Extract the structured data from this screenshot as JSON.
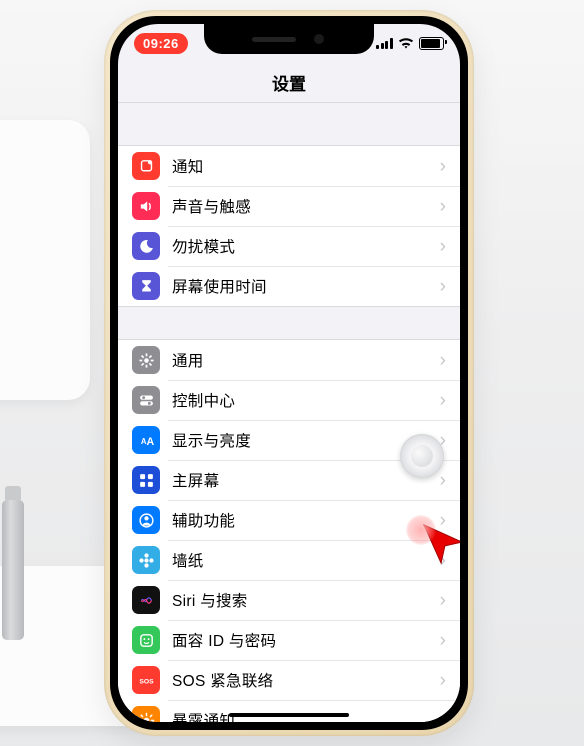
{
  "status": {
    "time": "09:26"
  },
  "header": {
    "title": "设置"
  },
  "groups": [
    {
      "items": [
        {
          "id": "notifications",
          "label": "通知",
          "icon": "bell",
          "color": "c-red"
        },
        {
          "id": "sounds",
          "label": "声音与触感",
          "icon": "speaker",
          "color": "c-pink"
        },
        {
          "id": "dnd",
          "label": "勿扰模式",
          "icon": "moon",
          "color": "c-purple"
        },
        {
          "id": "screentime",
          "label": "屏幕使用时间",
          "icon": "hourglass",
          "color": "c-purple"
        }
      ]
    },
    {
      "items": [
        {
          "id": "general",
          "label": "通用",
          "icon": "gear",
          "color": "c-grey"
        },
        {
          "id": "control",
          "label": "控制中心",
          "icon": "toggles",
          "color": "c-grey"
        },
        {
          "id": "display",
          "label": "显示与亮度",
          "icon": "aa",
          "color": "c-blue"
        },
        {
          "id": "homescreen",
          "label": "主屏幕",
          "icon": "grid",
          "color": "c-darkblue"
        },
        {
          "id": "accessibility",
          "label": "辅助功能",
          "icon": "person",
          "color": "c-blue"
        },
        {
          "id": "wallpaper",
          "label": "墙纸",
          "icon": "flower",
          "color": "c-cyan"
        },
        {
          "id": "siri",
          "label": "Siri 与搜索",
          "icon": "siri",
          "color": "c-black"
        },
        {
          "id": "faceid",
          "label": "面容 ID 与密码",
          "icon": "face",
          "color": "c-green"
        },
        {
          "id": "sos",
          "label": "SOS 紧急联络",
          "icon": "sos",
          "color": "c-red"
        },
        {
          "id": "exposure",
          "label": "暴露通知",
          "icon": "sun",
          "color": "c-orange"
        }
      ]
    }
  ]
}
